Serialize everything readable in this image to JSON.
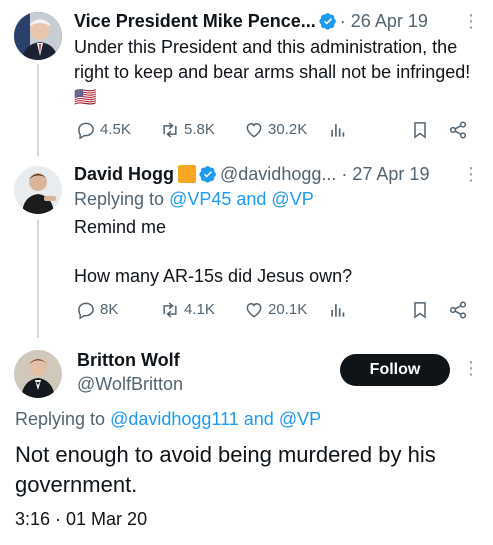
{
  "tweets": [
    {
      "name": "Vice President Mike Pence...",
      "handle": "",
      "date": "· 26 Apr 19",
      "text": "Under this President and this administration, the right to keep and bear arms shall not be infringed! 🇺🇸",
      "stats": {
        "replies": "4.5K",
        "retweets": "5.8K",
        "likes": "30.2K"
      }
    },
    {
      "name": "David Hogg",
      "handle": "@davidhogg...",
      "date": "· 27 Apr 19",
      "replying_prefix": "Replying to",
      "replying_to": "@VP45 and @VP",
      "text_line1": "Remind me",
      "text_line2": "How many AR-15s did Jesus own?",
      "stats": {
        "replies": "8K",
        "retweets": "4.1K",
        "likes": "20.1K"
      }
    },
    {
      "name": "Britton Wolf",
      "handle": "@WolfBritton",
      "follow_label": "Follow",
      "replying_prefix": "Replying to",
      "replying_to": "@davidhogg111 and @VP",
      "text": "Not enough to avoid being murdered by his government.",
      "timestamp": "3:16 · 01 Mar 20"
    }
  ],
  "colors": {
    "accent": "#1d9bf0",
    "text": "#0f1419",
    "muted": "#536471",
    "follow_bg": "#0f1419"
  },
  "icons": [
    "reply-icon",
    "retweet-icon",
    "like-icon",
    "views-icon",
    "bookmark-icon",
    "share-icon",
    "verified-icon",
    "more-icon"
  ]
}
